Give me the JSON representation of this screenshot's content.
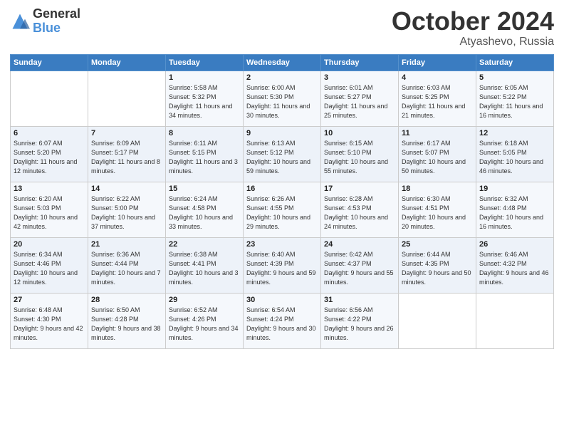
{
  "header": {
    "logo_line1": "General",
    "logo_line2": "Blue",
    "month": "October 2024",
    "location": "Atyashevo, Russia"
  },
  "weekdays": [
    "Sunday",
    "Monday",
    "Tuesday",
    "Wednesday",
    "Thursday",
    "Friday",
    "Saturday"
  ],
  "weeks": [
    [
      {
        "day": "",
        "sunrise": "",
        "sunset": "",
        "daylight": ""
      },
      {
        "day": "",
        "sunrise": "",
        "sunset": "",
        "daylight": ""
      },
      {
        "day": "1",
        "sunrise": "Sunrise: 5:58 AM",
        "sunset": "Sunset: 5:32 PM",
        "daylight": "Daylight: 11 hours and 34 minutes."
      },
      {
        "day": "2",
        "sunrise": "Sunrise: 6:00 AM",
        "sunset": "Sunset: 5:30 PM",
        "daylight": "Daylight: 11 hours and 30 minutes."
      },
      {
        "day": "3",
        "sunrise": "Sunrise: 6:01 AM",
        "sunset": "Sunset: 5:27 PM",
        "daylight": "Daylight: 11 hours and 25 minutes."
      },
      {
        "day": "4",
        "sunrise": "Sunrise: 6:03 AM",
        "sunset": "Sunset: 5:25 PM",
        "daylight": "Daylight: 11 hours and 21 minutes."
      },
      {
        "day": "5",
        "sunrise": "Sunrise: 6:05 AM",
        "sunset": "Sunset: 5:22 PM",
        "daylight": "Daylight: 11 hours and 16 minutes."
      }
    ],
    [
      {
        "day": "6",
        "sunrise": "Sunrise: 6:07 AM",
        "sunset": "Sunset: 5:20 PM",
        "daylight": "Daylight: 11 hours and 12 minutes."
      },
      {
        "day": "7",
        "sunrise": "Sunrise: 6:09 AM",
        "sunset": "Sunset: 5:17 PM",
        "daylight": "Daylight: 11 hours and 8 minutes."
      },
      {
        "day": "8",
        "sunrise": "Sunrise: 6:11 AM",
        "sunset": "Sunset: 5:15 PM",
        "daylight": "Daylight: 11 hours and 3 minutes."
      },
      {
        "day": "9",
        "sunrise": "Sunrise: 6:13 AM",
        "sunset": "Sunset: 5:12 PM",
        "daylight": "Daylight: 10 hours and 59 minutes."
      },
      {
        "day": "10",
        "sunrise": "Sunrise: 6:15 AM",
        "sunset": "Sunset: 5:10 PM",
        "daylight": "Daylight: 10 hours and 55 minutes."
      },
      {
        "day": "11",
        "sunrise": "Sunrise: 6:17 AM",
        "sunset": "Sunset: 5:07 PM",
        "daylight": "Daylight: 10 hours and 50 minutes."
      },
      {
        "day": "12",
        "sunrise": "Sunrise: 6:18 AM",
        "sunset": "Sunset: 5:05 PM",
        "daylight": "Daylight: 10 hours and 46 minutes."
      }
    ],
    [
      {
        "day": "13",
        "sunrise": "Sunrise: 6:20 AM",
        "sunset": "Sunset: 5:03 PM",
        "daylight": "Daylight: 10 hours and 42 minutes."
      },
      {
        "day": "14",
        "sunrise": "Sunrise: 6:22 AM",
        "sunset": "Sunset: 5:00 PM",
        "daylight": "Daylight: 10 hours and 37 minutes."
      },
      {
        "day": "15",
        "sunrise": "Sunrise: 6:24 AM",
        "sunset": "Sunset: 4:58 PM",
        "daylight": "Daylight: 10 hours and 33 minutes."
      },
      {
        "day": "16",
        "sunrise": "Sunrise: 6:26 AM",
        "sunset": "Sunset: 4:55 PM",
        "daylight": "Daylight: 10 hours and 29 minutes."
      },
      {
        "day": "17",
        "sunrise": "Sunrise: 6:28 AM",
        "sunset": "Sunset: 4:53 PM",
        "daylight": "Daylight: 10 hours and 24 minutes."
      },
      {
        "day": "18",
        "sunrise": "Sunrise: 6:30 AM",
        "sunset": "Sunset: 4:51 PM",
        "daylight": "Daylight: 10 hours and 20 minutes."
      },
      {
        "day": "19",
        "sunrise": "Sunrise: 6:32 AM",
        "sunset": "Sunset: 4:48 PM",
        "daylight": "Daylight: 10 hours and 16 minutes."
      }
    ],
    [
      {
        "day": "20",
        "sunrise": "Sunrise: 6:34 AM",
        "sunset": "Sunset: 4:46 PM",
        "daylight": "Daylight: 10 hours and 12 minutes."
      },
      {
        "day": "21",
        "sunrise": "Sunrise: 6:36 AM",
        "sunset": "Sunset: 4:44 PM",
        "daylight": "Daylight: 10 hours and 7 minutes."
      },
      {
        "day": "22",
        "sunrise": "Sunrise: 6:38 AM",
        "sunset": "Sunset: 4:41 PM",
        "daylight": "Daylight: 10 hours and 3 minutes."
      },
      {
        "day": "23",
        "sunrise": "Sunrise: 6:40 AM",
        "sunset": "Sunset: 4:39 PM",
        "daylight": "Daylight: 9 hours and 59 minutes."
      },
      {
        "day": "24",
        "sunrise": "Sunrise: 6:42 AM",
        "sunset": "Sunset: 4:37 PM",
        "daylight": "Daylight: 9 hours and 55 minutes."
      },
      {
        "day": "25",
        "sunrise": "Sunrise: 6:44 AM",
        "sunset": "Sunset: 4:35 PM",
        "daylight": "Daylight: 9 hours and 50 minutes."
      },
      {
        "day": "26",
        "sunrise": "Sunrise: 6:46 AM",
        "sunset": "Sunset: 4:32 PM",
        "daylight": "Daylight: 9 hours and 46 minutes."
      }
    ],
    [
      {
        "day": "27",
        "sunrise": "Sunrise: 6:48 AM",
        "sunset": "Sunset: 4:30 PM",
        "daylight": "Daylight: 9 hours and 42 minutes."
      },
      {
        "day": "28",
        "sunrise": "Sunrise: 6:50 AM",
        "sunset": "Sunset: 4:28 PM",
        "daylight": "Daylight: 9 hours and 38 minutes."
      },
      {
        "day": "29",
        "sunrise": "Sunrise: 6:52 AM",
        "sunset": "Sunset: 4:26 PM",
        "daylight": "Daylight: 9 hours and 34 minutes."
      },
      {
        "day": "30",
        "sunrise": "Sunrise: 6:54 AM",
        "sunset": "Sunset: 4:24 PM",
        "daylight": "Daylight: 9 hours and 30 minutes."
      },
      {
        "day": "31",
        "sunrise": "Sunrise: 6:56 AM",
        "sunset": "Sunset: 4:22 PM",
        "daylight": "Daylight: 9 hours and 26 minutes."
      },
      {
        "day": "",
        "sunrise": "",
        "sunset": "",
        "daylight": ""
      },
      {
        "day": "",
        "sunrise": "",
        "sunset": "",
        "daylight": ""
      }
    ]
  ]
}
